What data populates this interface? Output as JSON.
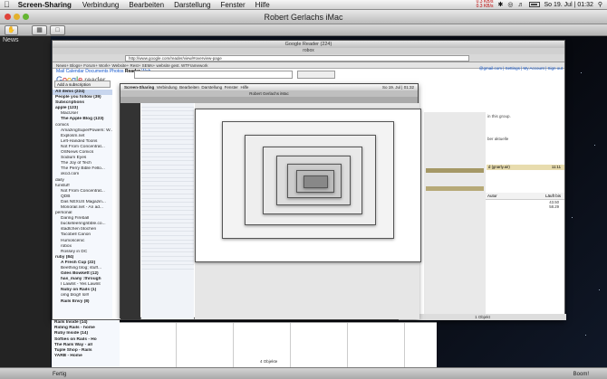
{
  "menubar": {
    "apple": "",
    "app": "Screen-Sharing",
    "items": [
      "Verbindung",
      "Bearbeiten",
      "Darstellung",
      "Fenster",
      "Hilfe"
    ],
    "net": [
      "0.3 KB/s",
      "0.3 KB/s"
    ],
    "clock": "So 19. Jul | 01:32"
  },
  "window": {
    "title": "Robert Gerlachs iMac"
  },
  "left": {
    "news": "News"
  },
  "reader": {
    "window_title": "Google Reader (224)",
    "tab": "robox",
    "url": "http://www.google.com/reader/view/#overview-page",
    "bookmarks": "News+  Blogs+  Forum+  Work+  Website+  Rest+  SEMs+  website gest.  WTFramework",
    "nav_links": [
      "Mail",
      "Calendar",
      "Documents",
      "Photos",
      "Reader",
      "Web"
    ],
    "logo_letters": [
      "G",
      "o",
      "o",
      "g",
      "l",
      "e"
    ],
    "logo_suffix": " reader",
    "add_subscription": "Add a subscription",
    "sidebar": [
      {
        "t": "All items (224)",
        "b": true,
        "ind": false
      },
      {
        "t": "People you follow (39)",
        "b": true,
        "ind": false
      },
      {
        "t": "Subscriptions",
        "b": true,
        "ind": false
      },
      {
        "t": "apple (123)",
        "b": true,
        "ind": false
      },
      {
        "t": "MacUser",
        "b": false,
        "ind": true
      },
      {
        "t": "The Apple Blog (123)",
        "b": true,
        "ind": true
      },
      {
        "t": "comics",
        "b": false,
        "ind": false
      },
      {
        "t": "AmazingSuperPowers: W...",
        "b": false,
        "ind": true
      },
      {
        "t": "Explosm.net",
        "b": false,
        "ind": true
      },
      {
        "t": "Left-Handed Toons",
        "b": false,
        "ind": true
      },
      {
        "t": "Not From Concentrat...",
        "b": false,
        "ind": true
      },
      {
        "t": "OSNews Comics",
        "b": false,
        "ind": true
      },
      {
        "t": "Sodium Eyes",
        "b": false,
        "ind": true
      },
      {
        "t": "The Joy of Tech",
        "b": false,
        "ind": true
      },
      {
        "t": "The Perry Bible Fello...",
        "b": false,
        "ind": true
      },
      {
        "t": "xkcd.com",
        "b": false,
        "ind": true
      },
      {
        "t": "daily",
        "b": false,
        "ind": false
      },
      {
        "t": "funstuff",
        "b": false,
        "ind": false
      },
      {
        "t": "Not From Concentrat...",
        "b": false,
        "ind": true
      },
      {
        "t": "QDB",
        "b": false,
        "ind": true
      },
      {
        "t": "Das NEXUS Magazin...",
        "b": false,
        "ind": true
      },
      {
        "t": "Monorail.net - An ad...",
        "b": false,
        "ind": true
      },
      {
        "t": "personal",
        "b": false,
        "ind": false
      },
      {
        "t": "Daring Fireball",
        "b": false,
        "ind": true
      },
      {
        "t": "bucketeeringribble.co...",
        "b": false,
        "ind": true
      },
      {
        "t": "stadtchen btochen",
        "b": false,
        "ind": true
      },
      {
        "t": "Tacobell Canon",
        "b": false,
        "ind": true
      },
      {
        "t": "Humoscenic",
        "b": false,
        "ind": true
      },
      {
        "t": "robox",
        "b": false,
        "ind": true
      },
      {
        "t": "Rossey in DC",
        "b": false,
        "ind": true
      },
      {
        "t": "ruby (84)",
        "b": true,
        "ind": false
      },
      {
        "t": "A Fresh Cup (22)",
        "b": true,
        "ind": true
      },
      {
        "t": "Beething blog; stuff...",
        "b": false,
        "ind": true
      },
      {
        "t": "Giles Bowkett (12)",
        "b": true,
        "ind": true
      },
      {
        "t": "has_many :through",
        "b": true,
        "ind": true
      },
      {
        "t": "I Lawlnt - Yes Lawlnt",
        "b": false,
        "ind": true
      },
      {
        "t": "Nuby on Rails (1)",
        "b": true,
        "ind": true
      },
      {
        "t": "omg blog!! lol!!",
        "b": false,
        "ind": true
      },
      {
        "t": "Rails Envy (8)",
        "b": true,
        "ind": true
      }
    ],
    "sidebar_more": [
      "Rails Inside (14)",
      "Riding Rails - home",
      "Ruby Inside (14)",
      "Softies on Rails - Ho",
      "The Rails Way - all",
      "Tuple Shop - Rails",
      "YARB - Home"
    ],
    "manage": "Manage subscriptions »",
    "toplinks": "@gmail.com | Settings | My Account | Sign out",
    "right_hdr": [
      "Autor",
      "Läuft bis"
    ],
    "right_values": [
      "43.50",
      "58.29"
    ],
    "group_text": "in this group.",
    "update_text": "ber aktuelle",
    "bar_label": "d (gnarly.air)",
    "bar_value": "11:11",
    "objects": "1 Objekt",
    "objects2": "4 Objekte"
  },
  "inner": {
    "menu": [
      "Screen-Sharing",
      "Verbindung",
      "Bearbeiten",
      "Darstellung",
      "Fenster",
      "Hilfe"
    ],
    "title": "Robert Gerlachs iMac",
    "clock": "So 19. Jul | 01:32"
  },
  "statusbar": {
    "left": "Fertig",
    "right": "Boom!"
  }
}
